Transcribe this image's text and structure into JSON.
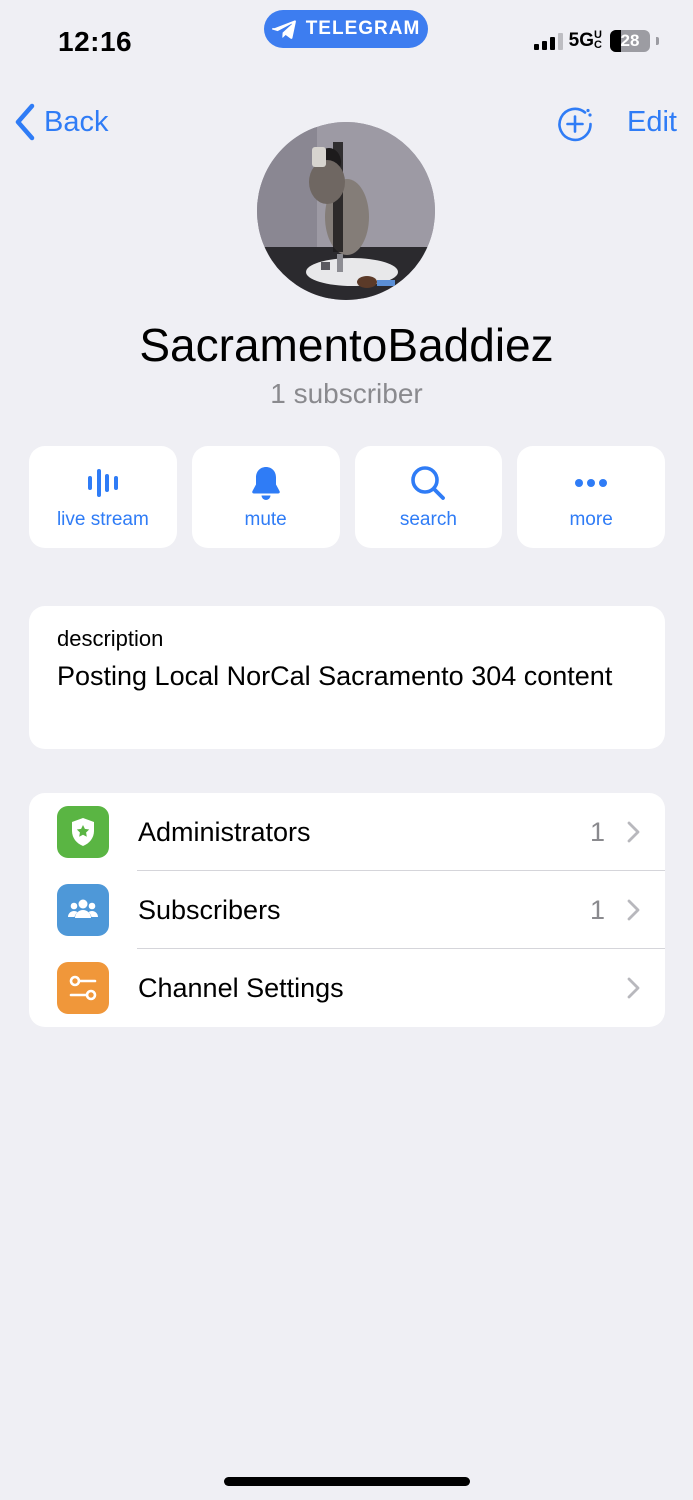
{
  "status_bar": {
    "time": "12:16",
    "app_pill": "TELEGRAM",
    "network": "5G",
    "network_sup": "UC",
    "battery": "28"
  },
  "nav": {
    "back_label": "Back",
    "edit_label": "Edit",
    "add_icon": "add-member-icon"
  },
  "channel": {
    "name": "SacramentoBaddiez",
    "subscribers": "1 subscriber"
  },
  "actions": [
    {
      "label": "live stream",
      "icon": "live-stream-icon"
    },
    {
      "label": "mute",
      "icon": "bell-icon"
    },
    {
      "label": "search",
      "icon": "search-icon"
    },
    {
      "label": "more",
      "icon": "more-icon"
    }
  ],
  "description": {
    "label": "description",
    "text": "Posting Local NorCal Sacramento 304 content"
  },
  "rows": [
    {
      "label": "Administrators",
      "value": "1",
      "icon": "admin-badge-icon",
      "color": "#5ab543"
    },
    {
      "label": "Subscribers",
      "value": "1",
      "icon": "people-icon",
      "color": "#4e98d8"
    },
    {
      "label": "Channel Settings",
      "value": "",
      "icon": "sliders-icon",
      "color": "#f0973a"
    }
  ],
  "colors": {
    "accent": "#2f7cf6",
    "background": "#efeff4",
    "pill": "#3d7df0"
  }
}
